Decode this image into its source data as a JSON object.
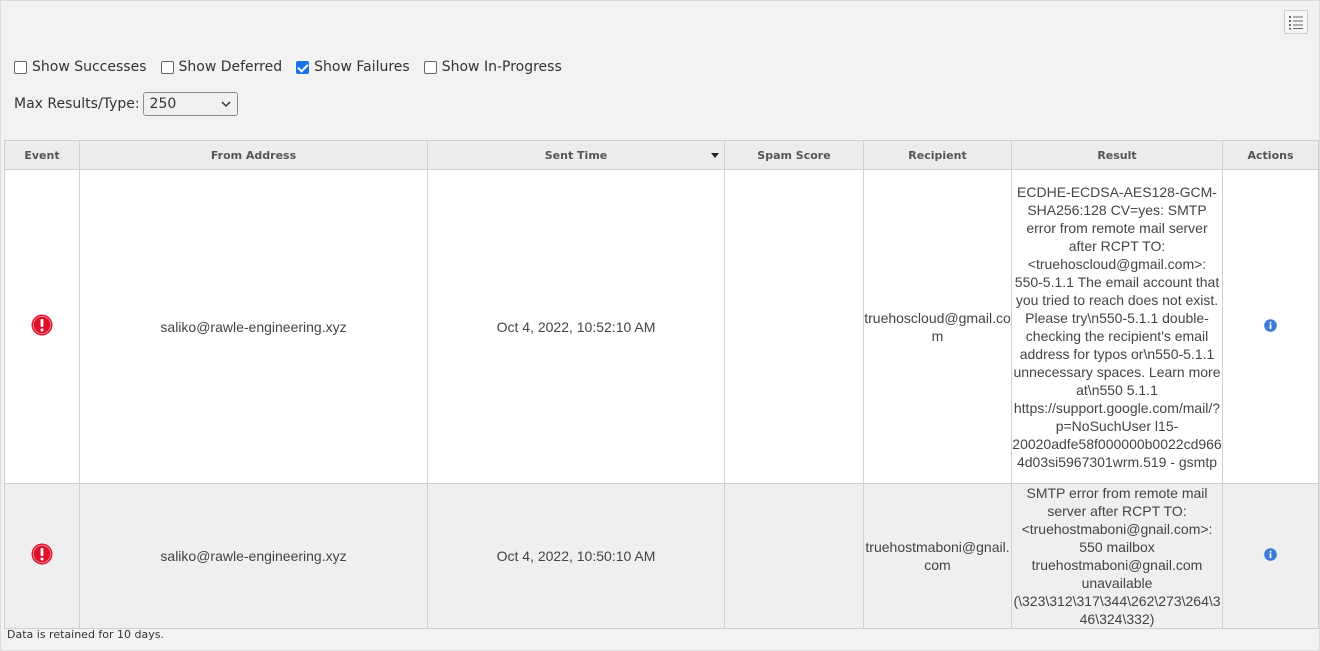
{
  "filters": [
    {
      "label": "Show Successes",
      "checked": false
    },
    {
      "label": "Show Deferred",
      "checked": false
    },
    {
      "label": "Show Failures",
      "checked": true
    },
    {
      "label": "Show In-Progress",
      "checked": false
    }
  ],
  "max_results": {
    "label": "Max Results/Type:",
    "value": "250"
  },
  "table": {
    "headers": [
      "Event",
      "From Address",
      "Sent Time",
      "Spam Score",
      "Recipient",
      "Result",
      "Actions"
    ],
    "sorted_column": "Sent Time",
    "rows": [
      {
        "event": "error-icon",
        "from": "saliko@rawle-engineering.xyz",
        "sent": "Oct 4, 2022, 10:52:10 AM",
        "spam": "",
        "recipient": "truehoscloud@gmail.com",
        "result": "ECDHE-ECDSA-AES128-GCM-SHA256:128 CV=yes: SMTP error from remote mail server after RCPT TO:<truehoscloud@gmail.com>: 550-5.1.1 The email account that you tried to reach does not exist. Please try\\n550-5.1.1 double-checking the recipient's email address for typos or\\n550-5.1.1 unnecessary spaces. Learn more at\\n550 5.1.1 https://support.google.com/mail/?p=NoSuchUser l15-20020adfe58f000000b0022cd9664d03si5967301wrm.519 - gsmtp",
        "action": "info-icon"
      },
      {
        "event": "error-icon",
        "from": "saliko@rawle-engineering.xyz",
        "sent": "Oct 4, 2022, 10:50:10 AM",
        "spam": "",
        "recipient": "truehostmaboni@gnail.com",
        "result": "SMTP error from remote mail server after RCPT TO:<truehostmaboni@gnail.com>: 550 mailbox truehostmaboni@gnail.com unavailable (\\323\\312\\317\\344\\262\\273\\264\\346\\324\\332)",
        "action": "info-icon"
      }
    ]
  },
  "footer": "Data is retained for 10 days.",
  "colors": {
    "error": "#e0102a",
    "info": "#3a7bd5",
    "checkbox_checked": "#1a73e8"
  }
}
